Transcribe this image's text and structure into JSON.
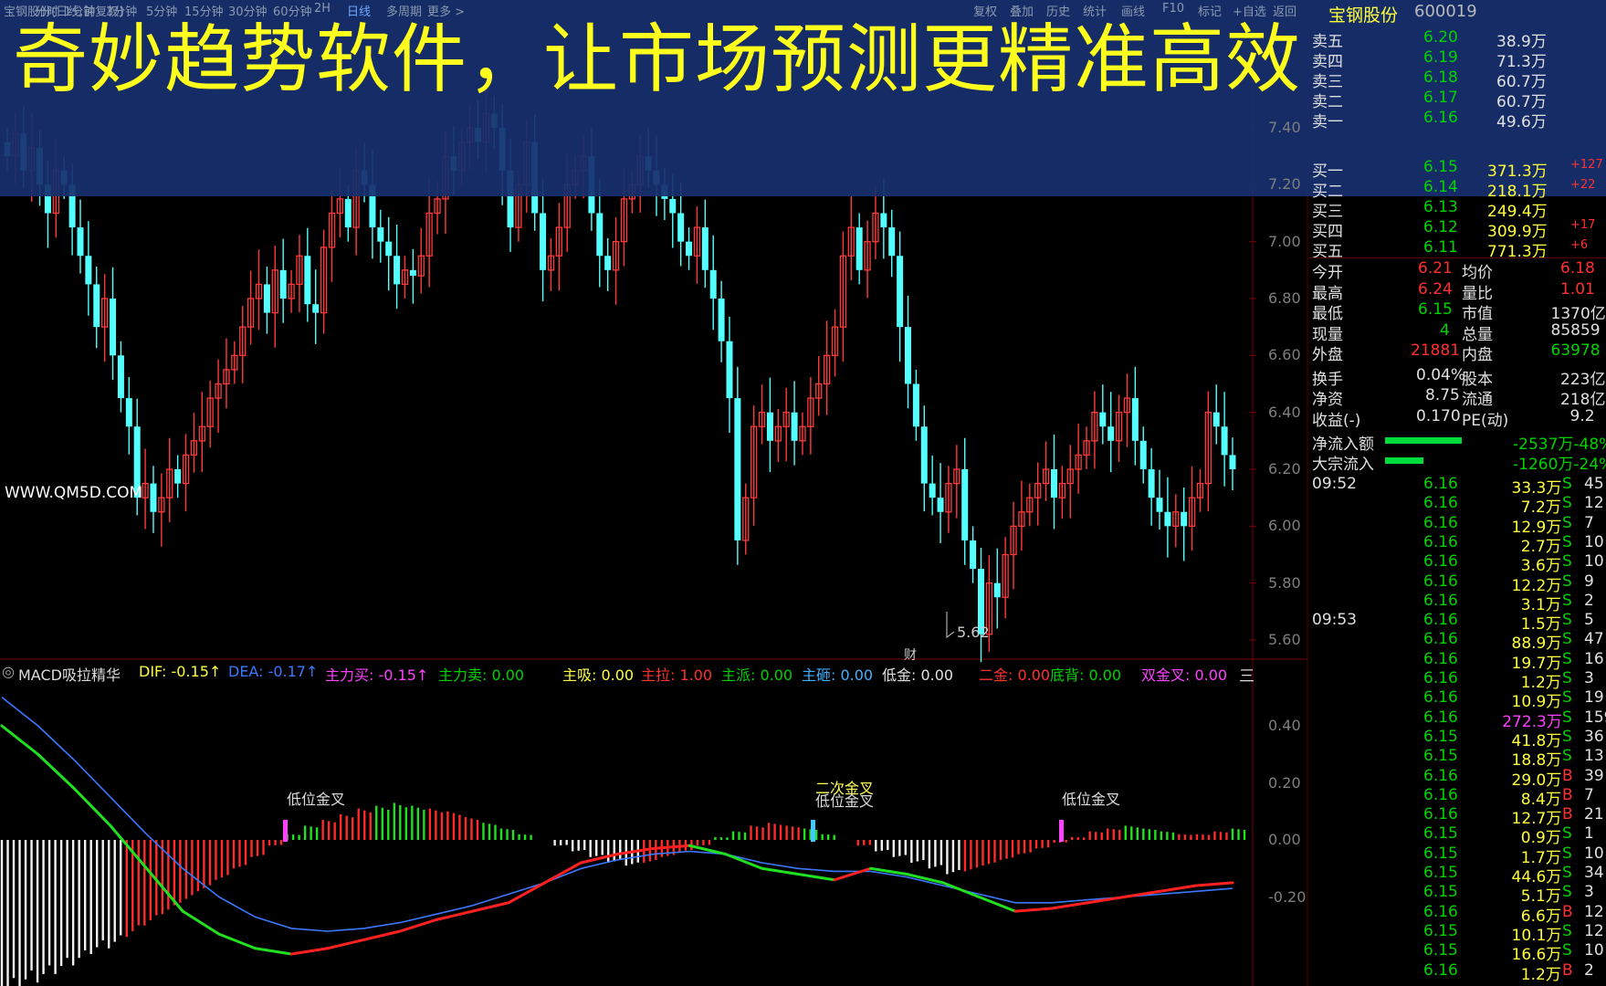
{
  "toolbar": {
    "left_items": [
      "分时",
      "1分钟",
      "3分钟",
      "5分钟",
      "15分钟",
      "30分钟",
      "60分钟",
      "2H",
      "日线",
      "多周期",
      "更多 >"
    ],
    "right_items": [
      "复权",
      "叠加",
      "历史",
      "统计",
      "画线",
      "F10",
      "标记",
      "+自选",
      "返回"
    ],
    "corner_left": "宝钢股份(日线,前复权)"
  },
  "headline": "奇妙趋势软件，让市场预测更精准高效",
  "stock": {
    "name": "宝钢股份",
    "code": "600019"
  },
  "watermark": "WWW.QM5D.COM",
  "price_axis": [
    "7.40",
    "7.20",
    "7.00",
    "6.80",
    "6.60",
    "6.40",
    "6.20",
    "6.00",
    "5.80",
    "5.60"
  ],
  "low_marker": "5.62",
  "finance_marker": "财",
  "macd_axis": [
    "0.40",
    "0.20",
    "0.00",
    "-0.20"
  ],
  "indicator_bar": {
    "name": "MACD吸拉精华",
    "items": [
      {
        "label": "DIF: -0.15↑",
        "color": "#ffff3c"
      },
      {
        "label": "DEA: -0.17↑",
        "color": "#3c78ff"
      },
      {
        "label": "主力买: -0.15↑",
        "color": "#ff40ff"
      },
      {
        "label": "主力卖: 0.00",
        "color": "#00d200"
      },
      {
        "label": "主吸: 0.00",
        "color": "#ffff3c"
      },
      {
        "label": "主拉: 1.00",
        "color": "#ff3030"
      },
      {
        "label": "主派: 0.00",
        "color": "#00d200"
      },
      {
        "label": "主砸: 0.00",
        "color": "#40b0ff"
      },
      {
        "label": "低金: 0.00",
        "color": "#e0e0e0"
      },
      {
        "label": "二金: 0.00",
        "color": "#ff3030"
      },
      {
        "label": "底背: 0.00",
        "color": "#00d200"
      },
      {
        "label": "双金叉: 0.00",
        "color": "#ff40ff"
      }
    ],
    "menu_icon": "三"
  },
  "annotations": [
    {
      "text": "低位金叉"
    },
    {
      "text": "二次金叉"
    },
    {
      "text": "低位金叉"
    },
    {
      "text": "低位金叉"
    }
  ],
  "order_book": {
    "sell": [
      {
        "label": "卖五",
        "price": "6.20",
        "vol": "38.9万"
      },
      {
        "label": "卖四",
        "price": "6.19",
        "vol": "71.3万"
      },
      {
        "label": "卖三",
        "price": "6.18",
        "vol": "60.7万"
      },
      {
        "label": "卖二",
        "price": "6.17",
        "vol": "60.7万"
      },
      {
        "label": "卖一",
        "price": "6.16",
        "vol": "49.6万"
      }
    ],
    "buy": [
      {
        "label": "买一",
        "price": "6.15",
        "vol": "371.3万",
        "chg": "+127"
      },
      {
        "label": "买二",
        "price": "6.14",
        "vol": "218.1万",
        "chg": "+22"
      },
      {
        "label": "买三",
        "price": "6.13",
        "vol": "249.4万",
        "chg": ""
      },
      {
        "label": "买四",
        "price": "6.12",
        "vol": "309.9万",
        "chg": "+17"
      },
      {
        "label": "买五",
        "price": "6.11",
        "vol": "771.3万",
        "chg": "+6"
      }
    ]
  },
  "quote": [
    {
      "l1": "今开",
      "v1": "6.21",
      "c1": "r",
      "l2": "均价",
      "v2": "6.18",
      "c2": "r"
    },
    {
      "l1": "最高",
      "v1": "6.24",
      "c1": "r",
      "l2": "量比",
      "v2": "1.01",
      "c2": "r"
    },
    {
      "l1": "最低",
      "v1": "6.15",
      "c1": "g",
      "l2": "市值",
      "v2": "1370亿",
      "c2": "w"
    },
    {
      "l1": "现量",
      "v1": "4",
      "c1": "g",
      "l2": "总量",
      "v2": "85859",
      "c2": "w"
    },
    {
      "l1": "外盘",
      "v1": "21881",
      "c1": "r",
      "l2": "内盘",
      "v2": "63978",
      "c2": "g"
    },
    {
      "l1": "换手",
      "v1": "0.04%",
      "c1": "w",
      "l2": "股本",
      "v2": "223亿",
      "c2": "w"
    },
    {
      "l1": "净资",
      "v1": "8.75",
      "c1": "w",
      "l2": "流通",
      "v2": "218亿",
      "c2": "w"
    },
    {
      "l1": "收益(-)",
      "v1": "0.170",
      "c1": "w",
      "l2": "PE(动)",
      "v2": "9.2",
      "c2": "w"
    }
  ],
  "flows": [
    {
      "label": "净流入额",
      "value": "-2537万-48%",
      "fill": 0.48
    },
    {
      "label": "大宗流入",
      "value": "-1260万-24%",
      "fill": 0.24
    }
  ],
  "ticks_times": [
    "09:52",
    "09:53"
  ],
  "ticks": [
    {
      "price": "6.16",
      "vol": "33.3万",
      "side": "S",
      "n": "45"
    },
    {
      "price": "6.16",
      "vol": "7.2万",
      "side": "S",
      "n": "12"
    },
    {
      "price": "6.16",
      "vol": "12.9万",
      "side": "S",
      "n": "7"
    },
    {
      "price": "6.16",
      "vol": "2.7万",
      "side": "S",
      "n": "10"
    },
    {
      "price": "6.16",
      "vol": "3.6万",
      "side": "S",
      "n": "10"
    },
    {
      "price": "6.16",
      "vol": "12.2万",
      "side": "S",
      "n": "9"
    },
    {
      "price": "6.16",
      "vol": "3.1万",
      "side": "S",
      "n": "2"
    },
    {
      "price": "6.16",
      "vol": "1.5万",
      "side": "S",
      "n": "5"
    },
    {
      "price": "6.16",
      "vol": "88.9万",
      "side": "S",
      "n": "47"
    },
    {
      "price": "6.16",
      "vol": "19.7万",
      "side": "S",
      "n": "16"
    },
    {
      "price": "6.16",
      "vol": "1.2万",
      "side": "S",
      "n": "3"
    },
    {
      "price": "6.16",
      "vol": "10.9万",
      "side": "S",
      "n": "19"
    },
    {
      "price": "6.16",
      "vol": "272.3万",
      "side": "S",
      "n": "159"
    },
    {
      "price": "6.15",
      "vol": "41.8万",
      "side": "S",
      "n": "36"
    },
    {
      "price": "6.15",
      "vol": "18.8万",
      "side": "S",
      "n": "13"
    },
    {
      "price": "6.16",
      "vol": "29.0万",
      "side": "B",
      "n": "39"
    },
    {
      "price": "6.16",
      "vol": "8.4万",
      "side": "B",
      "n": "7"
    },
    {
      "price": "6.16",
      "vol": "12.7万",
      "side": "B",
      "n": "21"
    },
    {
      "price": "6.15",
      "vol": "0.9万",
      "side": "S",
      "n": "1"
    },
    {
      "price": "6.15",
      "vol": "1.7万",
      "side": "S",
      "n": "10"
    },
    {
      "price": "6.15",
      "vol": "44.6万",
      "side": "S",
      "n": "34"
    },
    {
      "price": "6.15",
      "vol": "5.1万",
      "side": "S",
      "n": "3"
    },
    {
      "price": "6.16",
      "vol": "6.6万",
      "side": "B",
      "n": "12"
    },
    {
      "price": "6.15",
      "vol": "10.1万",
      "side": "S",
      "n": "12"
    },
    {
      "price": "6.15",
      "vol": "16.6万",
      "side": "S",
      "n": "10"
    },
    {
      "price": "6.16",
      "vol": "1.2万",
      "side": "B",
      "n": "2"
    }
  ],
  "chart_data": {
    "type": "candlestick",
    "ylim": [
      5.55,
      7.55
    ],
    "close_series": [
      7.3,
      7.38,
      7.25,
      7.33,
      7.2,
      7.1,
      7.25,
      7.2,
      7.05,
      6.95,
      6.85,
      6.7,
      6.8,
      6.6,
      6.45,
      6.35,
      6.1,
      6.15,
      6.05,
      6.1,
      6.2,
      6.15,
      6.25,
      6.3,
      6.35,
      6.45,
      6.5,
      6.55,
      6.6,
      6.7,
      6.8,
      6.85,
      6.75,
      6.9,
      6.8,
      6.85,
      6.95,
      6.78,
      6.75,
      6.98,
      7.1,
      7.15,
      7.05,
      7.25,
      7.2,
      7.05,
      7.0,
      6.95,
      6.85,
      6.9,
      6.88,
      6.95,
      7.1,
      7.15,
      7.3,
      7.25,
      7.35,
      7.4,
      7.35,
      7.45,
      7.4,
      7.25,
      7.05,
      7.2,
      7.35,
      7.1,
      6.9,
      6.95,
      7.05,
      7.2,
      7.25,
      7.3,
      7.1,
      6.95,
      6.9,
      7.0,
      7.15,
      7.2,
      7.3,
      7.25,
      7.2,
      7.15,
      7.1,
      7.0,
      6.95,
      7.05,
      6.9,
      6.8,
      6.65,
      6.45,
      5.95,
      6.1,
      6.35,
      6.4,
      6.3,
      6.35,
      6.4,
      6.3,
      6.35,
      6.45,
      6.5,
      6.6,
      6.7,
      6.95,
      7.05,
      6.9,
      7.0,
      7.1,
      7.05,
      6.95,
      6.7,
      6.5,
      6.35,
      6.15,
      6.1,
      6.05,
      6.15,
      6.2,
      5.95,
      5.85,
      5.62,
      5.8,
      5.75,
      5.9,
      6.0,
      6.05,
      6.1,
      6.15,
      6.2,
      6.1,
      6.15,
      6.2,
      6.25,
      6.3,
      6.4,
      6.35,
      6.3,
      6.4,
      6.45,
      6.3,
      6.2,
      6.1,
      6.05,
      6.0,
      6.05,
      6.0,
      6.1,
      6.15,
      6.4,
      6.35,
      6.25,
      6.2
    ],
    "macd_histogram": [
      -0.55,
      -0.52,
      -0.5,
      -0.47,
      -0.44,
      -0.4,
      -0.38,
      -0.34,
      -0.3,
      -0.26,
      -0.22,
      -0.18,
      -0.14,
      -0.1,
      -0.06,
      -0.02,
      0.02,
      0.05,
      0.07,
      0.09,
      0.11,
      0.12,
      0.13,
      0.12,
      0.11,
      0.1,
      0.08,
      0.06,
      0.04,
      0.02,
      0.0,
      -0.02,
      -0.04,
      -0.06,
      -0.08,
      -0.09,
      -0.08,
      -0.06,
      -0.04,
      -0.02,
      0.01,
      0.03,
      0.05,
      0.06,
      0.05,
      0.04,
      0.02,
      0.0,
      -0.02,
      -0.04,
      -0.06,
      -0.08,
      -0.1,
      -0.12,
      -0.11,
      -0.09,
      -0.07,
      -0.05,
      -0.03,
      -0.01,
      0.01,
      0.03,
      0.04,
      0.05,
      0.04,
      0.03,
      0.02,
      0.02,
      0.03,
      0.04
    ],
    "dif": [
      0.4,
      0.3,
      0.18,
      0.05,
      -0.1,
      -0.25,
      -0.33,
      -0.38,
      -0.4,
      -0.38,
      -0.35,
      -0.32,
      -0.28,
      -0.25,
      -0.22,
      -0.15,
      -0.08,
      -0.05,
      -0.03,
      -0.02,
      -0.05,
      -0.1,
      -0.12,
      -0.14,
      -0.1,
      -0.12,
      -0.15,
      -0.2,
      -0.25,
      -0.24,
      -0.22,
      -0.2,
      -0.18,
      -0.16,
      -0.15
    ],
    "dea": [
      0.5,
      0.4,
      0.28,
      0.15,
      0.02,
      -0.1,
      -0.2,
      -0.27,
      -0.31,
      -0.32,
      -0.31,
      -0.29,
      -0.26,
      -0.23,
      -0.19,
      -0.15,
      -0.1,
      -0.07,
      -0.05,
      -0.04,
      -0.05,
      -0.08,
      -0.1,
      -0.11,
      -0.11,
      -0.13,
      -0.16,
      -0.19,
      -0.22,
      -0.22,
      -0.21,
      -0.2,
      -0.19,
      -0.18,
      -0.17
    ]
  }
}
